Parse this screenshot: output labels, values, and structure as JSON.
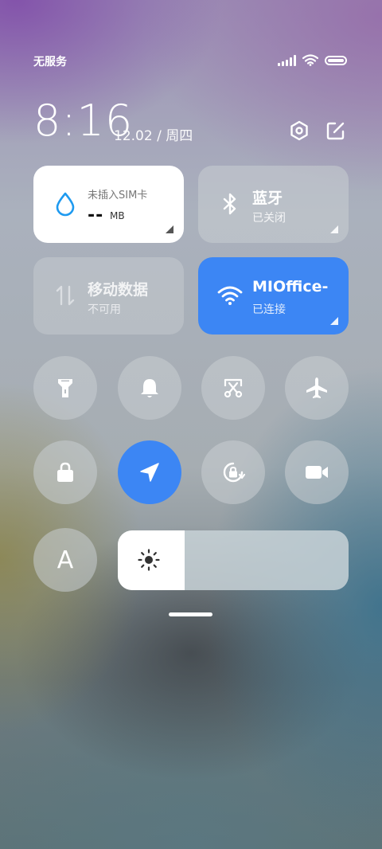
{
  "status_bar": {
    "carrier": "无服务",
    "icons": [
      "signal-icon",
      "wifi-icon",
      "battery-icon"
    ],
    "battery_level": 1.0
  },
  "header": {
    "time": "8:16",
    "date": "12.02 / 周四",
    "buttons": [
      "settings-icon",
      "edit-icon"
    ]
  },
  "tiles": {
    "data_usage": {
      "label": "未插入SIM卡",
      "value": "--",
      "unit": "MB",
      "icon": "water-drop-icon"
    },
    "bluetooth": {
      "title": "蓝牙",
      "subtitle": "已关闭",
      "icon": "bluetooth-icon"
    },
    "mobile_data": {
      "title": "移动数据",
      "subtitle": "不可用",
      "icon": "data-arrows-icon"
    },
    "wifi": {
      "title": "MIOffice-",
      "subtitle": "已连接",
      "icon": "wifi-icon"
    }
  },
  "toggles": [
    {
      "name": "flashlight",
      "icon": "flashlight-icon",
      "active": false
    },
    {
      "name": "ringer",
      "icon": "bell-icon",
      "active": false
    },
    {
      "name": "screenshot",
      "icon": "scissors-icon",
      "active": false
    },
    {
      "name": "airplane",
      "icon": "airplane-icon",
      "active": false
    },
    {
      "name": "lock",
      "icon": "lock-icon",
      "active": false
    },
    {
      "name": "location",
      "icon": "location-arrow-icon",
      "active": true
    },
    {
      "name": "rotation-lock",
      "icon": "rotation-lock-icon",
      "active": false
    },
    {
      "name": "screen-record",
      "icon": "video-camera-icon",
      "active": false
    }
  ],
  "auto_brightness": {
    "label": "A"
  },
  "brightness": {
    "level": 0.29,
    "icon": "sun-icon"
  },
  "colors": {
    "accent": "#3c86f4",
    "tile_gray": "rgba(200,205,210,0.55)",
    "text": "#ffffff"
  }
}
